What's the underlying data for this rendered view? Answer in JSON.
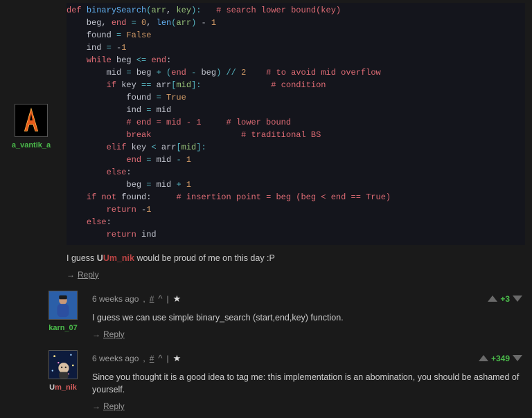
{
  "code_lines": [
    [
      [
        "k",
        "def"
      ],
      [
        " "
      ],
      [
        "fn",
        "binarySearch"
      ],
      [
        "op",
        "("
      ],
      [
        "s",
        "arr"
      ],
      [
        ", "
      ],
      [
        "s",
        "key"
      ],
      [
        "op",
        "):"
      ],
      [
        "   "
      ],
      [
        "cm",
        "# search lower bound(key)"
      ]
    ],
    [
      [
        "    beg, "
      ],
      [
        "k",
        "end"
      ],
      [
        " "
      ],
      [
        "op",
        "="
      ],
      [
        " "
      ],
      [
        "n",
        "0"
      ],
      [
        ", "
      ],
      [
        "fn",
        "len"
      ],
      [
        "op",
        "("
      ],
      [
        "s",
        "arr"
      ],
      [
        "op",
        ")"
      ],
      [
        " - "
      ],
      [
        "n",
        "1"
      ]
    ],
    [
      [
        "    found "
      ],
      [
        "op",
        "="
      ],
      [
        " "
      ],
      [
        "cst",
        "False"
      ]
    ],
    [
      [
        "    ind "
      ],
      [
        "op",
        "="
      ],
      [
        " -"
      ],
      [
        "n",
        "1"
      ]
    ],
    [
      [
        "    "
      ],
      [
        "k",
        "while"
      ],
      [
        " beg "
      ],
      [
        "op",
        "<="
      ],
      [
        " "
      ],
      [
        "k",
        "end"
      ],
      [
        ":"
      ]
    ],
    [
      [
        "        mid "
      ],
      [
        "op",
        "="
      ],
      [
        " beg "
      ],
      [
        "op",
        "+"
      ],
      [
        " "
      ],
      [
        "op",
        "("
      ],
      [
        "k",
        "end"
      ],
      [
        " "
      ],
      [
        "op",
        "-"
      ],
      [
        " beg"
      ],
      [
        "op",
        ")"
      ],
      [
        " "
      ],
      [
        "op",
        "//"
      ],
      [
        " "
      ],
      [
        "n",
        "2"
      ],
      [
        "    "
      ],
      [
        "cm",
        "# to avoid mid overflow"
      ]
    ],
    [
      [
        "        "
      ],
      [
        "k",
        "if"
      ],
      [
        " key "
      ],
      [
        "op",
        "=="
      ],
      [
        " arr"
      ],
      [
        "op",
        "["
      ],
      [
        "s",
        "mid"
      ],
      [
        "op",
        "]:"
      ],
      [
        "              "
      ],
      [
        "cm",
        "# condition"
      ]
    ],
    [
      [
        "            found "
      ],
      [
        "op",
        "="
      ],
      [
        " "
      ],
      [
        "cst",
        "True"
      ]
    ],
    [
      [
        "            ind "
      ],
      [
        "op",
        "="
      ],
      [
        " mid"
      ]
    ],
    [
      [
        "            "
      ],
      [
        "cm",
        "# end = mid - 1     # lower bound"
      ]
    ],
    [
      [
        "            "
      ],
      [
        "k",
        "break"
      ],
      [
        "                  "
      ],
      [
        "cm",
        "# traditional BS"
      ]
    ],
    [
      [
        "        "
      ],
      [
        "k",
        "elif"
      ],
      [
        " key "
      ],
      [
        "op",
        "<"
      ],
      [
        " arr"
      ],
      [
        "op",
        "["
      ],
      [
        "s",
        "mid"
      ],
      [
        "op",
        "]:"
      ]
    ],
    [
      [
        "            "
      ],
      [
        "k",
        "end"
      ],
      [
        " "
      ],
      [
        "op",
        "="
      ],
      [
        " mid "
      ],
      [
        "op",
        "-"
      ],
      [
        " "
      ],
      [
        "n",
        "1"
      ]
    ],
    [
      [
        "        "
      ],
      [
        "k",
        "else"
      ],
      [
        ":"
      ]
    ],
    [
      [
        "            beg "
      ],
      [
        "op",
        "="
      ],
      [
        " mid "
      ],
      [
        "op",
        "+"
      ],
      [
        " "
      ],
      [
        "n",
        "1"
      ]
    ],
    [
      [
        "    "
      ],
      [
        "k",
        "if"
      ],
      [
        " "
      ],
      [
        "k",
        "not"
      ],
      [
        " found:     "
      ],
      [
        "cm",
        "# insertion point = beg (beg < end == True)"
      ]
    ],
    [
      [
        "        "
      ],
      [
        "k",
        "return"
      ],
      [
        " -"
      ],
      [
        "n",
        "1"
      ]
    ],
    [
      [
        "    "
      ],
      [
        "k",
        "else"
      ],
      [
        ":"
      ]
    ],
    [
      [
        "        "
      ],
      [
        "k",
        "return"
      ],
      [
        " ind"
      ]
    ]
  ],
  "c0": {
    "user": "a_vantik_a",
    "text_prefix": "I guess ",
    "mention": "Um_nik",
    "text_suffix": " would be proud of me on this day :P",
    "reply": "Reply"
  },
  "c1": {
    "user": "karn_07",
    "time": "6 weeks ago",
    "text": "I guess we can use simple binary_search (start,end,key) function.",
    "reply": "Reply",
    "score": "+3"
  },
  "c2": {
    "user": "Um_nik",
    "time": "6 weeks ago",
    "text": "Since you thought it is a good idea to tag me: this implementation is an abomination, you should be ashamed of yourself.",
    "reply": "Reply",
    "score": "+349"
  },
  "icons": {
    "hash": "#",
    "caret": "^",
    "sep": "|",
    "star": "★"
  }
}
